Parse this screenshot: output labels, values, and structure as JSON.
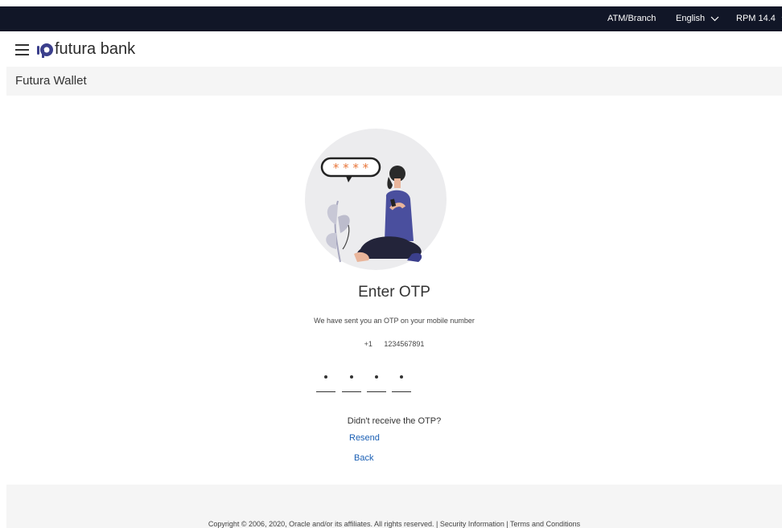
{
  "topbar": {
    "atm_branch": "ATM/Branch",
    "language": "English",
    "user": "RPM 14.4"
  },
  "header": {
    "logo_text": "futura bank"
  },
  "page": {
    "title": "Futura Wallet"
  },
  "otp": {
    "heading": "Enter OTP",
    "message": "We have sent you an OTP on your mobile number",
    "country_code": "+1",
    "mobile_number": "1234567891",
    "digits": [
      "•",
      "•",
      "•",
      "•"
    ],
    "resend_prompt": "Didn't receive the OTP?",
    "resend_link": "Resend",
    "back_link": "Back"
  },
  "footer": {
    "copyright": "Copyright © 2006, 2020, Oracle and/or its affiliates. All rights reserved. | Security Information | Terms and Conditions"
  },
  "colors": {
    "topbar_bg": "#111627",
    "link": "#1a5fb4",
    "accent": "#3b3f8c",
    "star": "#e8763a"
  }
}
